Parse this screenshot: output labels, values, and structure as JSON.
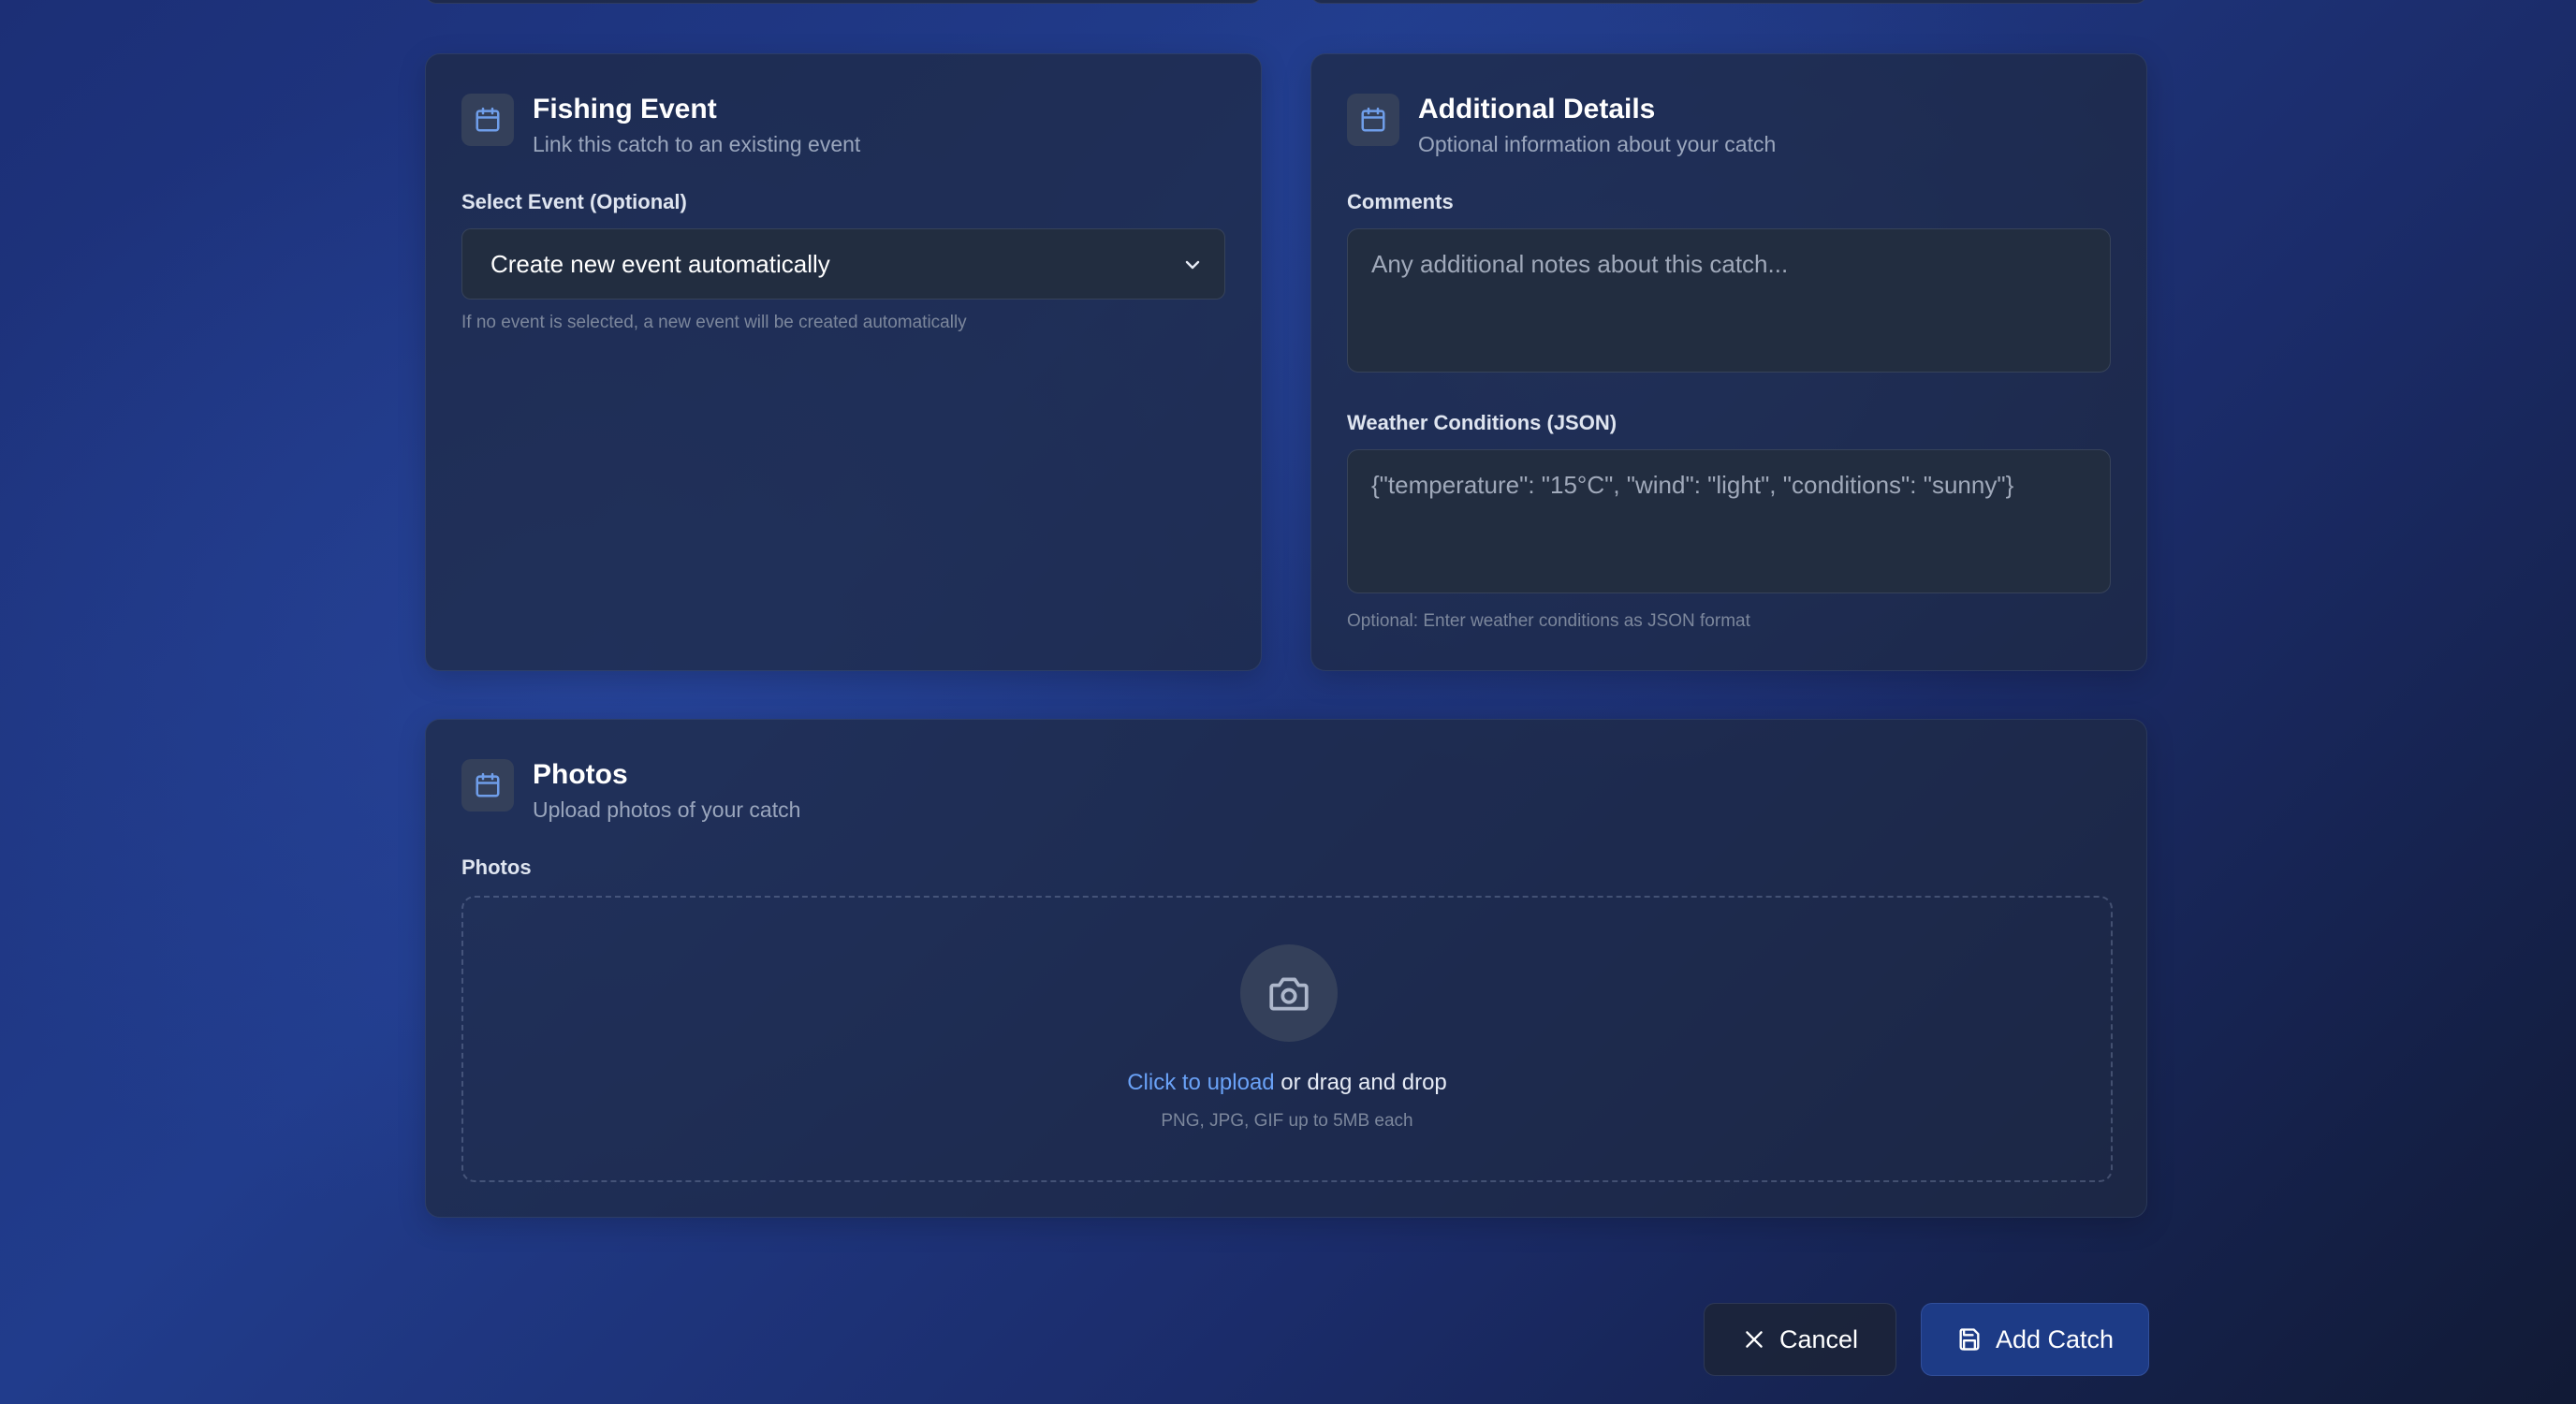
{
  "fishing_event": {
    "title": "Fishing Event",
    "subtitle": "Link this catch to an existing event",
    "select_label": "Select Event (Optional)",
    "select_value": "Create new event automatically",
    "hint": "If no event is selected, a new event will be created automatically"
  },
  "additional_details": {
    "title": "Additional Details",
    "subtitle": "Optional information about your catch",
    "comments_label": "Comments",
    "comments_placeholder": "Any additional notes about this catch...",
    "weather_label": "Weather Conditions (JSON)",
    "weather_placeholder": "{\"temperature\": \"15°C\", \"wind\": \"light\", \"conditions\": \"sunny\"}",
    "weather_hint": "Optional: Enter weather conditions as JSON format"
  },
  "photos": {
    "title": "Photos",
    "subtitle": "Upload photos of your catch",
    "label": "Photos",
    "upload_link": "Click to upload",
    "upload_rest": " or drag and drop",
    "upload_hint": "PNG, JPG, GIF up to 5MB each"
  },
  "actions": {
    "cancel_label": "Cancel",
    "add_label": "Add Catch"
  },
  "icons": {
    "section_icon": "calendar-icon",
    "upload_icon": "camera-icon",
    "select_icon": "chevron-down-icon",
    "cancel_icon": "close-icon",
    "add_icon": "save-icon"
  },
  "colors": {
    "accent_link": "#6aa2f7",
    "primary_button": "#1d3b86",
    "icon_blue": "#6f9eea"
  }
}
